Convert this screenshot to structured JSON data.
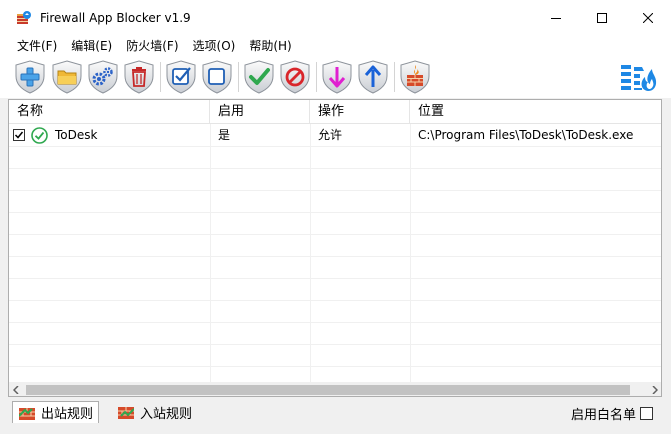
{
  "window": {
    "title": "Firewall App Blocker v1.9"
  },
  "menu": [
    "文件(F)",
    "编辑(E)",
    "防火墙(F)",
    "选项(O)",
    "帮助(H)"
  ],
  "toolbar": {
    "icons": [
      "add-icon",
      "open-folder-icon",
      "settings-gears-icon",
      "delete-icon",
      "check-all-icon",
      "uncheck-all-icon",
      "allow-icon",
      "block-icon",
      "move-down-icon",
      "move-up-icon",
      "firewall-icon"
    ],
    "right_icon": "firewall-menu-icon"
  },
  "table": {
    "columns": [
      "名称",
      "启用",
      "操作",
      "位置"
    ],
    "rows": [
      {
        "checked": true,
        "name": "ToDesk",
        "enabled": "是",
        "action": "允许",
        "path": "C:\\Program Files\\ToDesk\\ToDesk.exe"
      }
    ]
  },
  "tabs": [
    "出站规则",
    "入站规则"
  ],
  "whitelist_label": "启用白名单",
  "colors": {
    "allow": "#2fa84f",
    "block": "#d9262b",
    "down": "#e020d0",
    "up": "#1a62d8",
    "accent": "#1e88e5"
  }
}
